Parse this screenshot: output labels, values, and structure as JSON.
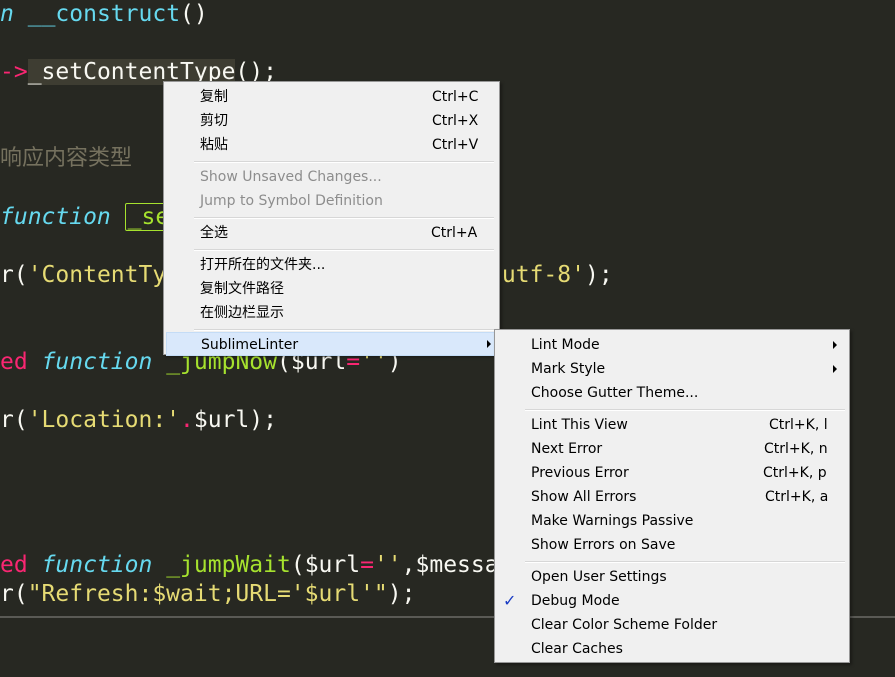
{
  "editor": {
    "line1": {
      "kw": "n",
      "sp": " ",
      "fn": "__construct",
      "rest": "()"
    },
    "line2": {
      "arrow": "->",
      "call": "_setContentType",
      "rest": "();"
    },
    "line3": {
      "comment": "响应内容类型"
    },
    "line4": {
      "kw": "function",
      "sp": " ",
      "fn": "_se"
    },
    "line5": {
      "pre": "r(",
      "str1": "'ContentTy",
      "eq": "=",
      "str2": " utf-8'",
      "post": ");"
    },
    "line6": {
      "stor": "ed",
      "sp": " ",
      "kw": "function",
      "fn": "_jumpNow",
      "paren": "(",
      "var": "$url",
      "eq": "=",
      "str": "''",
      "close": ")"
    },
    "line7": {
      "pre": "r(",
      "str": "'Location:'",
      "dot": ".",
      "var": "$url",
      "post": ");"
    },
    "line8": {
      "stor": "ed",
      "sp": " ",
      "kw": "function",
      "fn": "_jumpWait",
      "paren": "(",
      "var": "$url",
      "eq": "=",
      "str": "''",
      "comma": ",",
      "var2": "$messa"
    },
    "line9": {
      "pre": "r(",
      "str": "\"Refresh:$wait;URL='$url'\"",
      "post": ");"
    }
  },
  "context_menu": {
    "items": [
      {
        "label": "复制",
        "shortcut": "Ctrl+C"
      },
      {
        "label": "剪切",
        "shortcut": "Ctrl+X"
      },
      {
        "label": "粘贴",
        "shortcut": "Ctrl+V"
      },
      {
        "label": "Show Unsaved Changes...",
        "shortcut": ""
      },
      {
        "label": "Jump to Symbol Definition",
        "shortcut": ""
      },
      {
        "label": "全选",
        "shortcut": "Ctrl+A"
      },
      {
        "label": "打开所在的文件夹...",
        "shortcut": ""
      },
      {
        "label": "复制文件路径",
        "shortcut": ""
      },
      {
        "label": "在侧边栏显示",
        "shortcut": ""
      },
      {
        "label": "SublimeLinter",
        "shortcut": ""
      }
    ]
  },
  "submenu": {
    "items": [
      {
        "label": "Lint Mode",
        "shortcut": ""
      },
      {
        "label": "Mark Style",
        "shortcut": ""
      },
      {
        "label": "Choose Gutter Theme...",
        "shortcut": ""
      },
      {
        "label": "Lint This View",
        "shortcut": "Ctrl+K, l"
      },
      {
        "label": "Next Error",
        "shortcut": "Ctrl+K, n"
      },
      {
        "label": "Previous Error",
        "shortcut": "Ctrl+K, p"
      },
      {
        "label": "Show All Errors",
        "shortcut": "Ctrl+K, a"
      },
      {
        "label": "Make Warnings Passive",
        "shortcut": ""
      },
      {
        "label": "Show Errors on Save",
        "shortcut": ""
      },
      {
        "label": "Open User Settings",
        "shortcut": ""
      },
      {
        "label": "Debug Mode",
        "shortcut": "",
        "checked": true,
        "check": "✓"
      },
      {
        "label": "Clear Color Scheme Folder",
        "shortcut": ""
      },
      {
        "label": "Clear Caches",
        "shortcut": ""
      }
    ]
  },
  "colors": {
    "background": "#272822",
    "keyword": "#66d9ef",
    "storage": "#f92672",
    "function": "#a6e22e",
    "string": "#e6db74",
    "menu_bg": "#f0f0f0",
    "hover": "#d9e8fb",
    "check": "#1a3cc4"
  }
}
